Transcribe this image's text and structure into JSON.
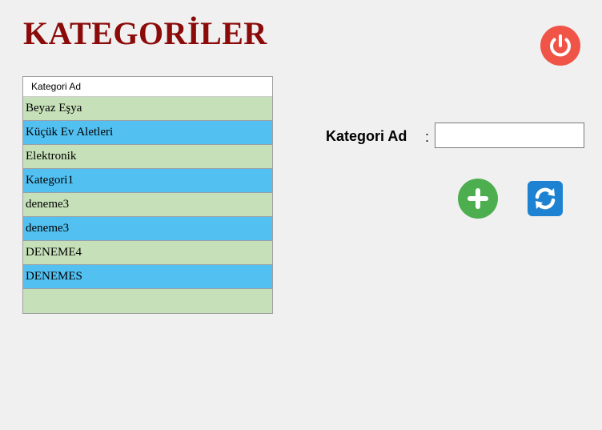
{
  "header": {
    "title": "KATEGORİLER"
  },
  "grid": {
    "column_header": "Kategori Ad",
    "rows": [
      "Beyaz Eşya",
      "Küçük Ev Aletleri",
      "Elektronik",
      "Kategori1",
      "deneme3",
      "deneme3",
      "DENEME4",
      "DENEMES"
    ]
  },
  "form": {
    "label": "Kategori Ad",
    "colon": ":",
    "input_value": ""
  },
  "icons": {
    "power": "power-icon",
    "add": "plus-circle-icon",
    "refresh": "refresh-icon"
  },
  "colors": {
    "title": "#8b0a0a",
    "row_alt_green": "#c6e0b9",
    "row_alt_blue": "#52c0f0",
    "power": "#f05446",
    "add": "#4cae4f",
    "refresh": "#1c82d1"
  }
}
